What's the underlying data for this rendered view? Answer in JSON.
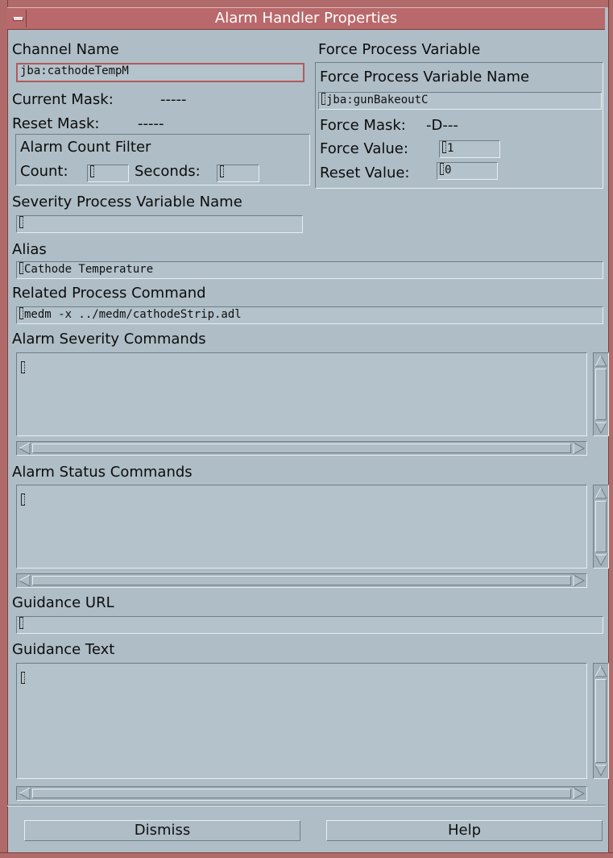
{
  "window": {
    "title": "Alarm Handler Properties"
  },
  "channel": {
    "label": "Channel Name",
    "value": "jba:cathodeTempM",
    "current_mask_label": "Current Mask:",
    "current_mask_value": "-----",
    "reset_mask_label": "Reset Mask:",
    "reset_mask_value": "-----"
  },
  "count_filter": {
    "title": "Alarm Count Filter",
    "count_label": "Count:",
    "count_value": "",
    "seconds_label": "Seconds:",
    "seconds_value": ""
  },
  "force_pv": {
    "section_label": "Force Process Variable",
    "name_label": "Force Process Variable Name",
    "name_value": "jba:gunBakeoutC",
    "mask_label": "Force Mask:",
    "mask_value": "-D---",
    "force_value_label": "Force Value:",
    "force_value": "1",
    "reset_value_label": "Reset Value:",
    "reset_value": "0"
  },
  "severity_pv": {
    "label": "Severity Process Variable Name",
    "value": ""
  },
  "alias": {
    "label": "Alias",
    "value": "Cathode Temperature"
  },
  "related_command": {
    "label": "Related Process Command",
    "value": "medm -x ../medm/cathodeStrip.adl"
  },
  "severity_commands": {
    "label": "Alarm Severity Commands",
    "value": ""
  },
  "status_commands": {
    "label": "Alarm Status Commands",
    "value": ""
  },
  "guidance_url": {
    "label": "Guidance URL",
    "value": ""
  },
  "guidance_text": {
    "label": "Guidance Text",
    "value": ""
  },
  "buttons": {
    "dismiss": "Dismiss",
    "help": "Help"
  },
  "icons": [
    "window-menu-icon",
    "text-cursor-icon",
    "arrow-up-icon",
    "arrow-down-icon",
    "arrow-left-icon",
    "arrow-right-icon"
  ],
  "colors": {
    "background": "#aebdc6",
    "titlebar": "#b9696b",
    "focus_border": "#b25a5a"
  }
}
